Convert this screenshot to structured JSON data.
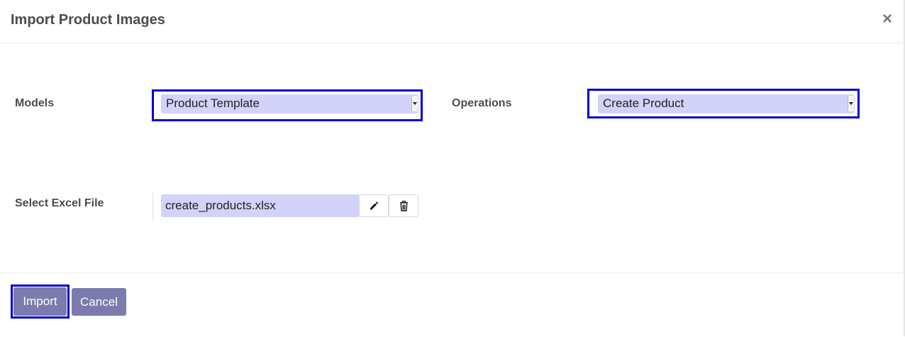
{
  "dialog": {
    "title": "Import Product Images",
    "close_symbol": "×"
  },
  "form": {
    "models": {
      "label": "Models",
      "value": "Product Template"
    },
    "operations": {
      "label": "Operations",
      "value": "Create Product"
    },
    "excel_file": {
      "label": "Select Excel File",
      "value": "create_products.xlsx",
      "edit_icon": "pencil-icon",
      "delete_icon": "trash-icon"
    }
  },
  "footer": {
    "import_label": "Import",
    "cancel_label": "Cancel"
  },
  "colors": {
    "highlight_border": "#0000cc",
    "field_background": "#d3d2f8",
    "button_background": "#7c7bad"
  }
}
